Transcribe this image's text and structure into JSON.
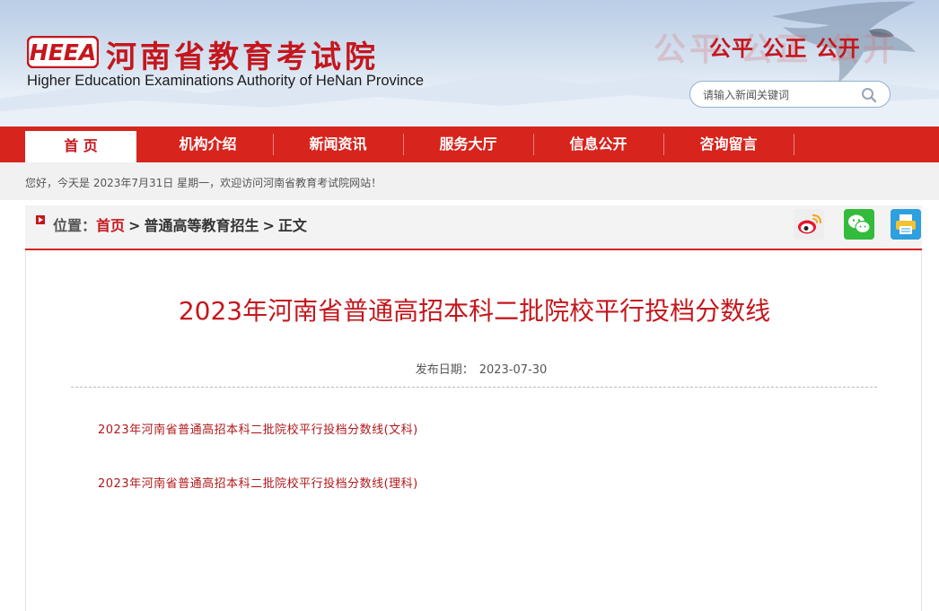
{
  "header": {
    "logo_text": "HEEA",
    "title_cn": "河南省教育考试院",
    "title_en": "Higher Education Examinations Authority of HeNan Province",
    "slogan": "公平 公正 公开",
    "slogan_shadow": "公平 公正 公开",
    "search_placeholder": "请输入新闻关键词"
  },
  "nav": {
    "items": [
      {
        "label": "首 页",
        "active": true
      },
      {
        "label": "机构介绍"
      },
      {
        "label": "新闻资讯"
      },
      {
        "label": "服务大厅"
      },
      {
        "label": "信息公开"
      },
      {
        "label": "咨询留言"
      }
    ]
  },
  "greeting": "您好，今天是 2023年7月31日 星期一，欢迎访问河南省教育考试院网站！",
  "breadcrumb": {
    "label": "位置：",
    "items": [
      "首页",
      "普通高等教育招生",
      "正文"
    ],
    "separator": ">"
  },
  "share": {
    "icons": [
      "weibo-icon",
      "wechat-icon",
      "print-icon"
    ]
  },
  "article": {
    "title": "2023年河南省普通高招本科二批院校平行投档分数线",
    "date_label": "发布日期：",
    "date_value": "2023-07-30",
    "attachments": [
      "2023年河南省普通高招本科二批院校平行投档分数线(文科)",
      "2023年河南省普通高招本科二批院校平行投档分数线(理科)"
    ]
  },
  "colors": {
    "brand_red": "#d7241d",
    "title_red": "#c4171d",
    "link_red": "#b0181b"
  }
}
